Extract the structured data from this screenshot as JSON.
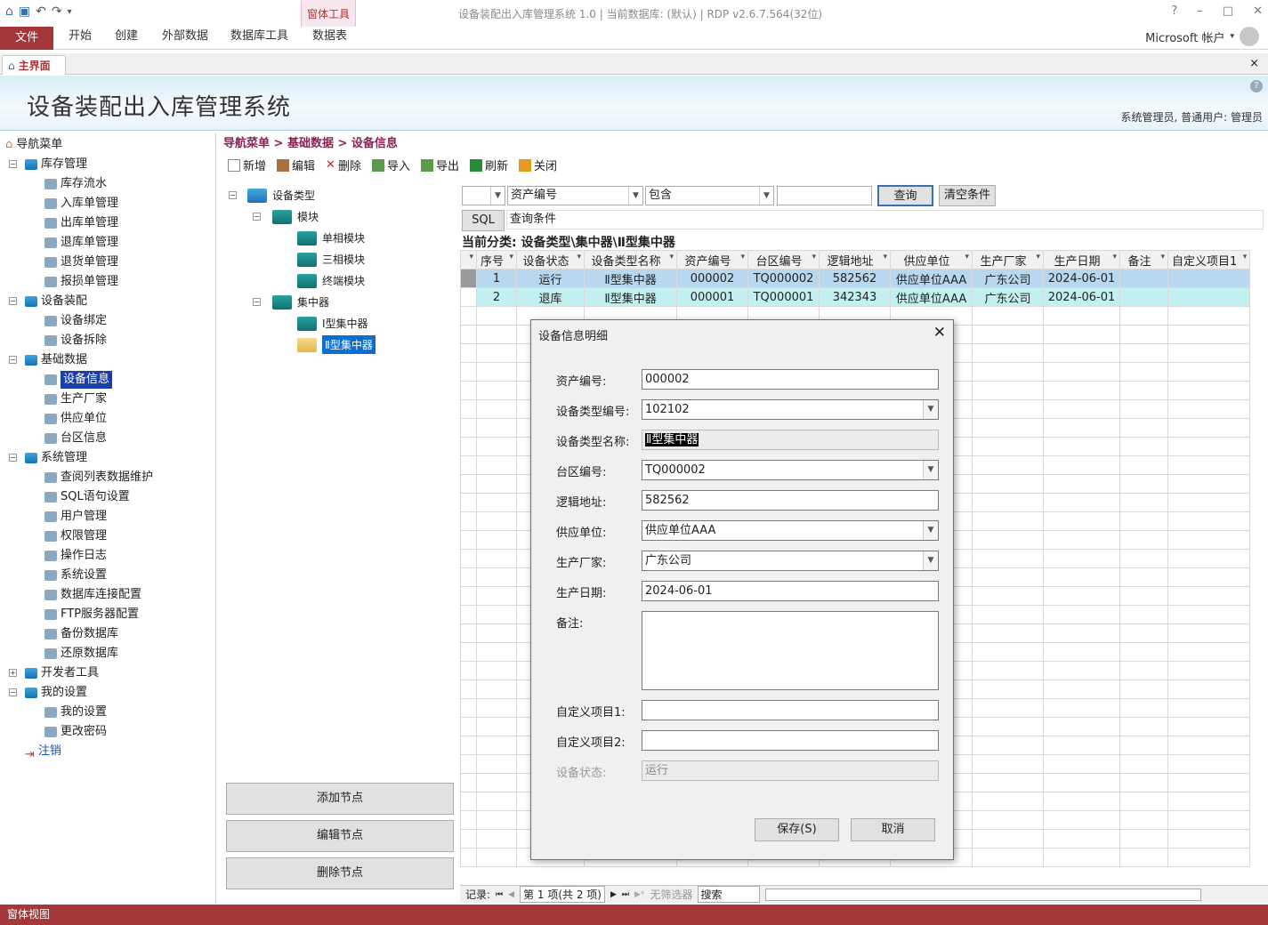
{
  "window": {
    "title": "设备装配出入库管理系统 1.0 | 当前数据库: (默认) | RDP v2.6.7.564(32位)",
    "context_group": "窗体工具",
    "help": "?",
    "minimize": "–",
    "maximize": "□",
    "close": "✕"
  },
  "ribbon": {
    "file": "文件",
    "tabs": [
      "开始",
      "创建",
      "外部数据",
      "数据库工具",
      "数据表"
    ],
    "account": "Microsoft 帐户"
  },
  "doc_tab": {
    "label": "主界面",
    "close": "×"
  },
  "banner": {
    "title": "设备装配出入库管理系统",
    "user_info": "系统管理员, 普通用户: 管理员",
    "help": "?"
  },
  "nav": {
    "root": "导航菜单",
    "items": [
      {
        "label": "库存管理",
        "level": 1
      },
      {
        "label": "库存流水",
        "level": 2
      },
      {
        "label": "入库单管理",
        "level": 2
      },
      {
        "label": "出库单管理",
        "level": 2
      },
      {
        "label": "退库单管理",
        "level": 2
      },
      {
        "label": "退货单管理",
        "level": 2
      },
      {
        "label": "报损单管理",
        "level": 2
      },
      {
        "label": "设备装配",
        "level": 1
      },
      {
        "label": "设备绑定",
        "level": 2
      },
      {
        "label": "设备拆除",
        "level": 2
      },
      {
        "label": "基础数据",
        "level": 1
      },
      {
        "label": "设备信息",
        "level": 2,
        "selected": true
      },
      {
        "label": "生产厂家",
        "level": 2
      },
      {
        "label": "供应单位",
        "level": 2
      },
      {
        "label": "台区信息",
        "level": 2
      },
      {
        "label": "系统管理",
        "level": 1
      },
      {
        "label": "查阅列表数据维护",
        "level": 2
      },
      {
        "label": "SQL语句设置",
        "level": 2
      },
      {
        "label": "用户管理",
        "level": 2
      },
      {
        "label": "权限管理",
        "level": 2
      },
      {
        "label": "操作日志",
        "level": 2
      },
      {
        "label": "系统设置",
        "level": 2
      },
      {
        "label": "数据库连接配置",
        "level": 2
      },
      {
        "label": "FTP服务器配置",
        "level": 2
      },
      {
        "label": "备份数据库",
        "level": 2
      },
      {
        "label": "还原数据库",
        "level": 2
      },
      {
        "label": "开发者工具",
        "level": 1
      },
      {
        "label": "我的设置",
        "level": 1
      },
      {
        "label": "我的设置",
        "level": 2
      },
      {
        "label": "更改密码",
        "level": 2
      },
      {
        "label": "注销",
        "level": 1
      }
    ]
  },
  "breadcrumb": "导航菜单 > 基础数据 > 设备信息",
  "toolbar": {
    "add": "新增",
    "edit": "编辑",
    "delete": "删除",
    "import": "导入",
    "export": "导出",
    "refresh": "刷新",
    "close": "关闭"
  },
  "tree": {
    "root": "设备类型",
    "module": "模块",
    "single": "单相模块",
    "three": "三相模块",
    "terminal": "终端模块",
    "concentrator": "集中器",
    "type1": "Ⅰ型集中器",
    "type2": "Ⅱ型集中器",
    "add_node": "添加节点",
    "edit_node": "编辑节点",
    "delete_node": "删除节点"
  },
  "filter": {
    "field": "资产编号",
    "op": "包含",
    "query": "查询",
    "clear": "清空条件",
    "sql": "SQL",
    "sql_text": "查询条件"
  },
  "current_category": "当前分类: 设备类型\\集中器\\Ⅱ型集中器",
  "grid": {
    "columns": [
      "序号",
      "设备状态",
      "设备类型名称",
      "资产编号",
      "台区编号",
      "逻辑地址",
      "供应单位",
      "生产厂家",
      "生产日期",
      "备注",
      "自定义项目1"
    ],
    "rows": [
      [
        "1",
        "运行",
        "Ⅱ型集中器",
        "000002",
        "TQ000002",
        "582562",
        "供应单位AAA",
        "广东公司",
        "2024-06-01",
        "",
        ""
      ],
      [
        "2",
        "退库",
        "Ⅱ型集中器",
        "000001",
        "TQ000001",
        "342343",
        "供应单位AAA",
        "广东公司",
        "2024-06-01",
        "",
        ""
      ]
    ]
  },
  "recbar": {
    "label": "记录:",
    "nav_first": "⏮",
    "nav_prev": "◀",
    "position": "第 1 项(共 2 项)",
    "nav_next": "▶",
    "nav_last": "⏭",
    "nav_new": "▶*",
    "filter": "无筛选器",
    "search": "搜索"
  },
  "statusbar": "窗体视图",
  "dialog": {
    "title": "设备信息明细",
    "fields": {
      "asset_no": {
        "label": "资产编号:",
        "value": "000002"
      },
      "type_no": {
        "label": "设备类型编号:",
        "value": "102102"
      },
      "type_name": {
        "label": "设备类型名称:",
        "value": "Ⅱ型集中器"
      },
      "area_no": {
        "label": "台区编号:",
        "value": "TQ000002"
      },
      "logic_addr": {
        "label": "逻辑地址:",
        "value": "582562"
      },
      "supplier": {
        "label": "供应单位:",
        "value": "供应单位AAA"
      },
      "maker": {
        "label": "生产厂家:",
        "value": "广东公司"
      },
      "date": {
        "label": "生产日期:",
        "value": "2024-06-01"
      },
      "remark": {
        "label": "备注:",
        "value": ""
      },
      "custom1": {
        "label": "自定义项目1:",
        "value": ""
      },
      "custom2": {
        "label": "自定义项目2:",
        "value": ""
      },
      "status": {
        "label": "设备状态:",
        "value": "运行"
      }
    },
    "save": "保存(S)",
    "cancel": "取消"
  }
}
